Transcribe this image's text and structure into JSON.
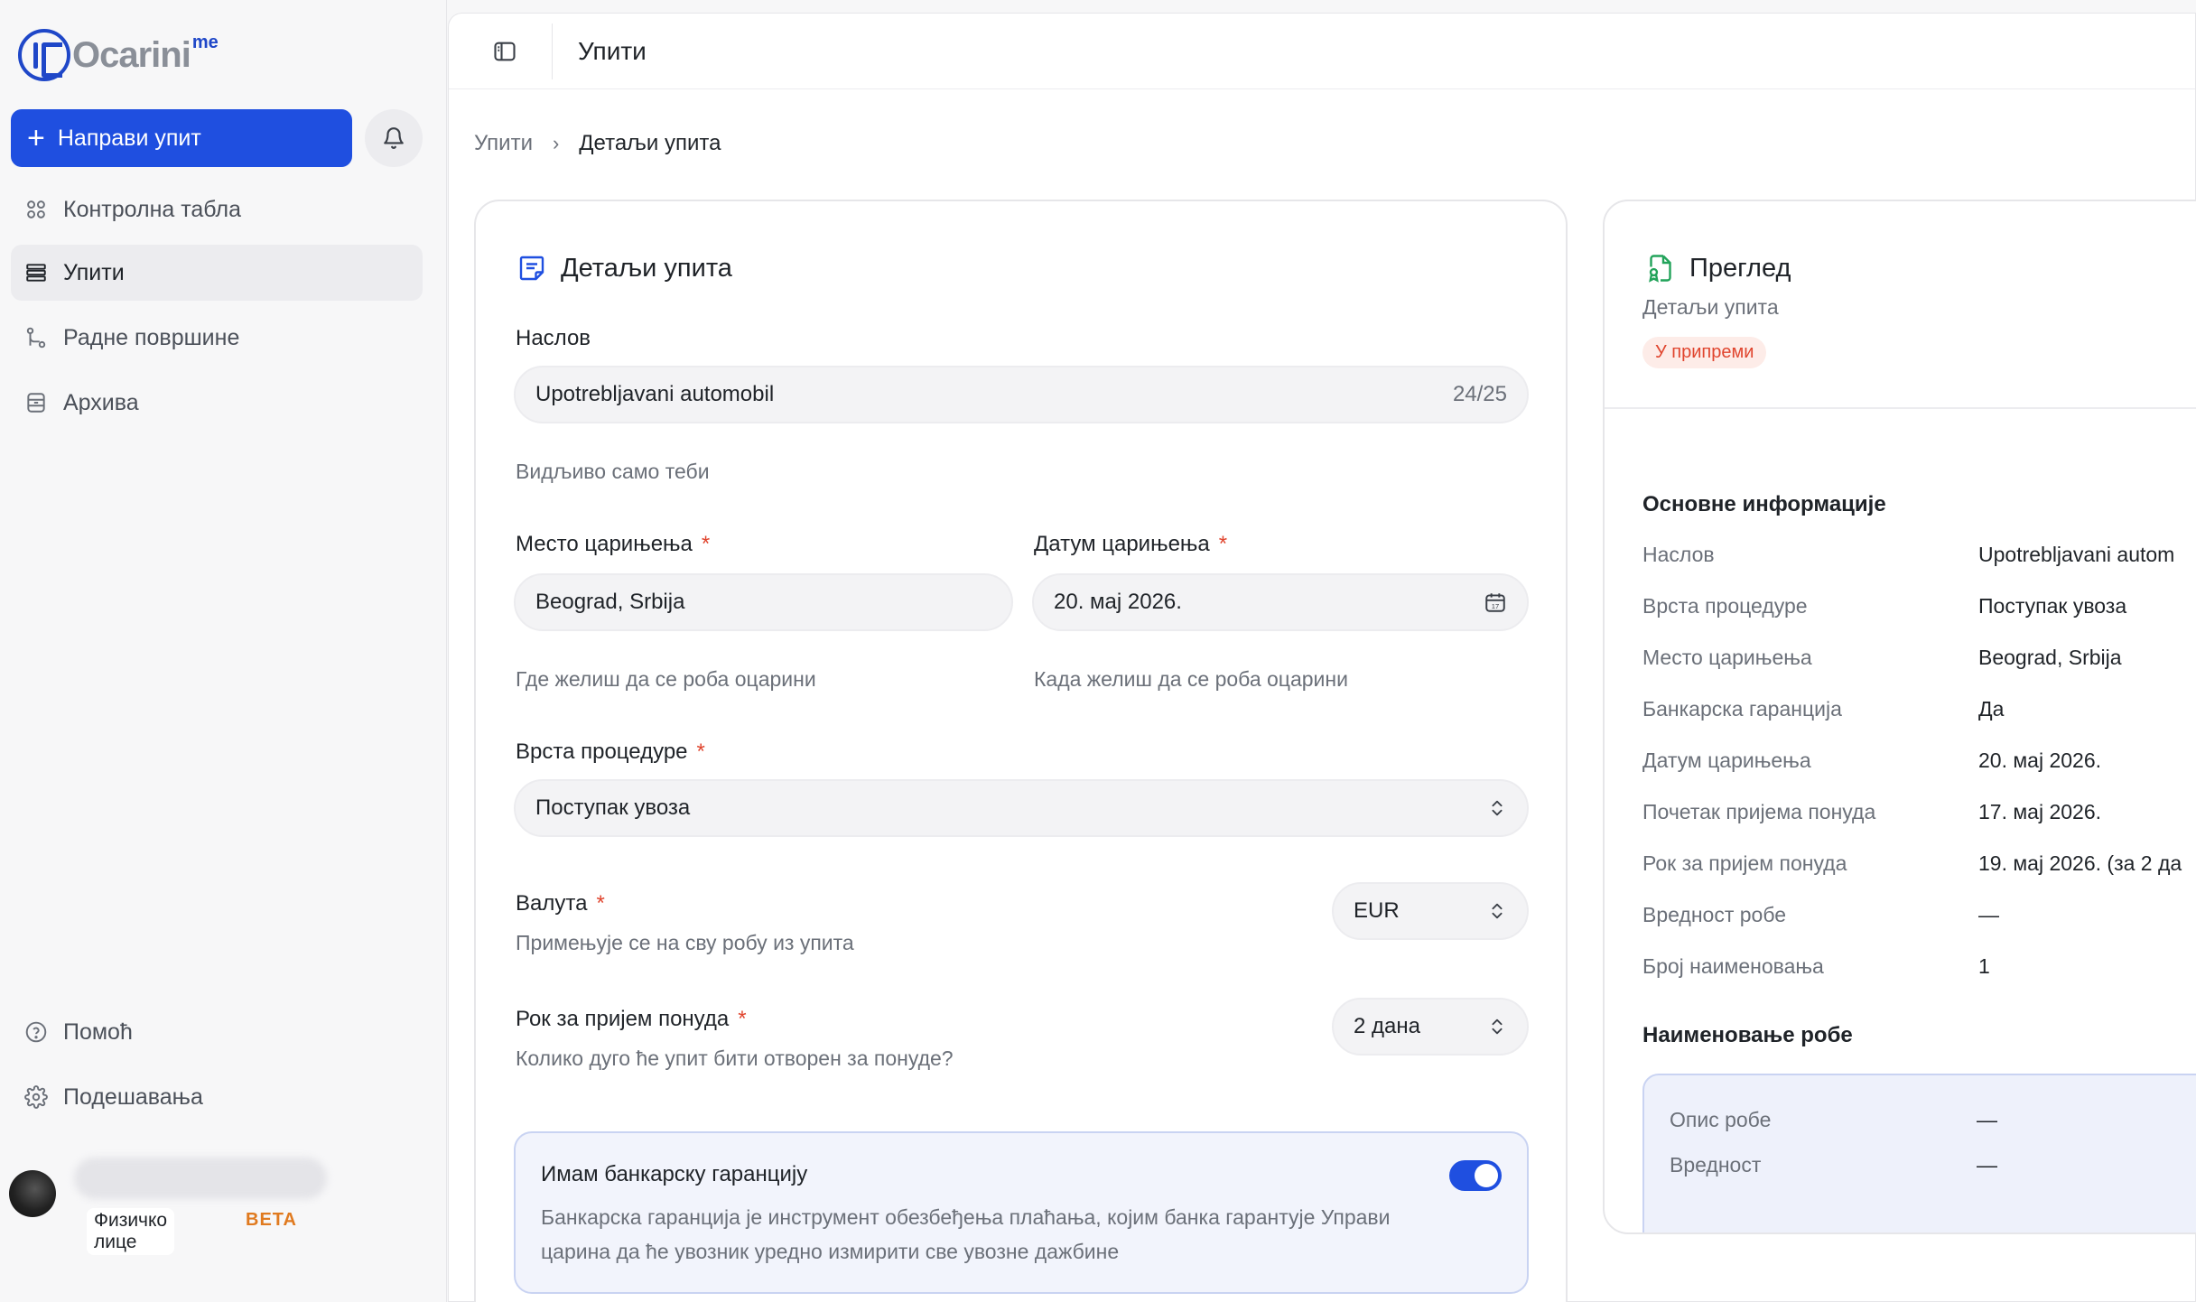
{
  "brand": {
    "name": "Ocarini",
    "sup": "me"
  },
  "sidebar": {
    "new_button": "Направи упит",
    "items": [
      {
        "label": "Контролна табла",
        "icon": "dashboard-icon"
      },
      {
        "label": "Упити",
        "icon": "list-icon",
        "active": true
      },
      {
        "label": "Радне површине",
        "icon": "workspace-icon"
      },
      {
        "label": "Архива",
        "icon": "archive-icon"
      }
    ],
    "bottom_items": [
      {
        "label": "Помоћ",
        "icon": "help-icon"
      },
      {
        "label": "Подешавања",
        "icon": "gear-icon"
      }
    ],
    "user": {
      "type": "Физичко лице",
      "badge": "BETA"
    }
  },
  "topbar": {
    "title": "Упити"
  },
  "breadcrumb": {
    "parent": "Упити",
    "current": "Детаљи упита"
  },
  "form": {
    "heading": "Детаљи упита",
    "title": {
      "label": "Наслов",
      "value": "Upotrebljavani automobil",
      "counter": "24/25",
      "hint": "Видљиво само теби"
    },
    "place": {
      "label": "Место цариње‌ња",
      "value": "Beograd, Srbija",
      "hint": "Где желиш да се роба оцарини"
    },
    "date": {
      "label": "Датум цариње‌ња",
      "value": "20. мај 2026.",
      "hint": "Када желиш да се роба оцарини"
    },
    "procedure": {
      "label": "Врста процедуре",
      "value": "Поступак увоза"
    },
    "currency": {
      "label": "Валута",
      "hint": "Примењује се на сву робу из упита",
      "value": "EUR"
    },
    "deadline": {
      "label": "Рок за пријем понуда",
      "hint": "Колико дуго ће упит бити отворен за понуде?",
      "value": "2 дана"
    },
    "guarantee": {
      "title": "Имам банкарску гаранцију",
      "desc": "Банкарска гаранција је инструмент обезбеђења плаћања, којим банка гарантује Управи царина да ће увозник уредно измирити све увозне дажбине",
      "enabled": true
    }
  },
  "preview": {
    "heading": "Преглед",
    "subtitle": "Детаљи упита",
    "status": "У припреми",
    "basic_title": "Основне информације",
    "rows": [
      {
        "k": "Наслов",
        "v": "Upotrebljavani autom"
      },
      {
        "k": "Врста процедуре",
        "v": "Поступак увоза"
      },
      {
        "k": "Место цариње‌ња",
        "v": "Beograd, Srbija"
      },
      {
        "k": "Банкарска гаранција",
        "v": "Да"
      },
      {
        "k": "Датум цариње‌ња",
        "v": "20. мај 2026."
      },
      {
        "k": "Почетак пријема понуда",
        "v": "17. мај 2026."
      },
      {
        "k": "Рок за пријем понуда",
        "v": "19. мај 2026. (за 2 да"
      },
      {
        "k": "Вредност робе",
        "v": "—"
      },
      {
        "k": "Број наименовања",
        "v": "1"
      }
    ],
    "goods_title": "Наименовање робе",
    "goods_rows": [
      {
        "k": "Опис робе",
        "v": "—"
      },
      {
        "k": "Вредност",
        "v": "—"
      }
    ]
  }
}
